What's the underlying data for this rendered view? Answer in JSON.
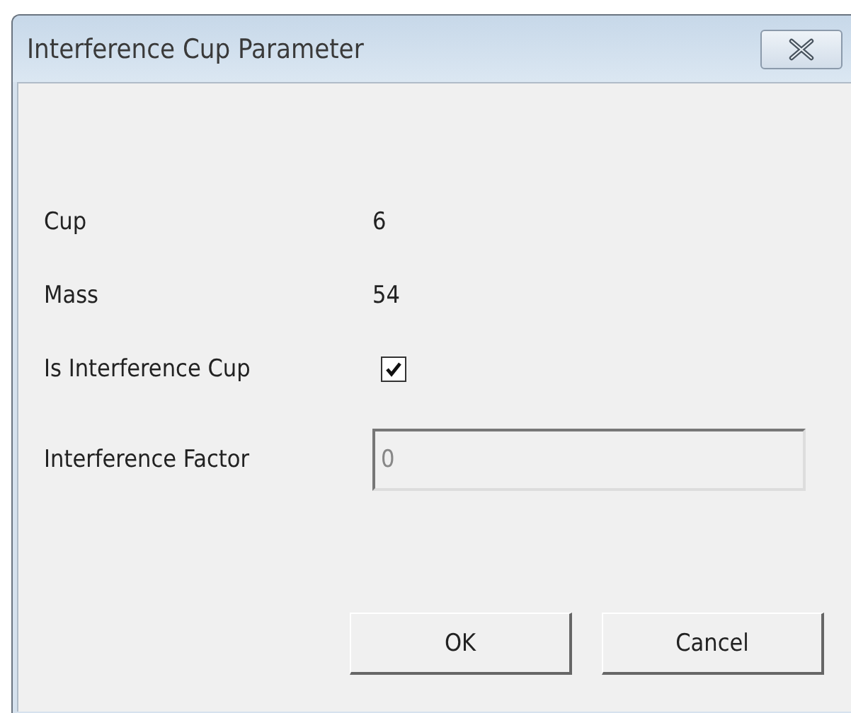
{
  "window": {
    "title": "Interference Cup Parameter"
  },
  "fields": [
    {
      "kind": "text",
      "label": "Cup",
      "value": "6"
    },
    {
      "kind": "text",
      "label": "Mass",
      "value": "54"
    },
    {
      "kind": "checkbox",
      "label": "Is Interference Cup",
      "checked": true
    },
    {
      "kind": "input",
      "label": "Interference Factor",
      "value": "0",
      "disabled": true
    }
  ],
  "buttons": [
    "OK",
    "Cancel"
  ]
}
